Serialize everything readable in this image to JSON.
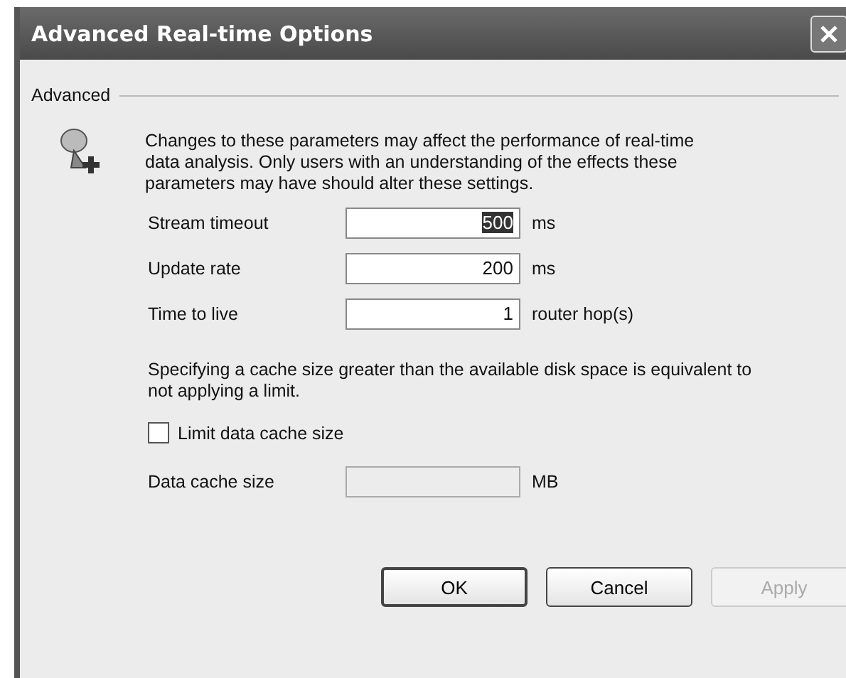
{
  "window": {
    "title": "Advanced Real-time Options"
  },
  "group": {
    "label": "Advanced"
  },
  "intro": "Changes to these parameters may affect the performance of real-time data analysis.  Only users with an understanding of the effects these parameters may have should alter these settings.",
  "fields": [
    {
      "label": "Stream timeout",
      "value": "500",
      "unit": "ms",
      "selected": true
    },
    {
      "label": "Update rate",
      "value": "200",
      "unit": "ms",
      "selected": false
    },
    {
      "label": "Time to live",
      "value": "1",
      "unit": "router hop(s)",
      "selected": false
    }
  ],
  "cache_note": "Specifying a cache size greater than the available disk space is equivalent to not applying a limit.",
  "limit_checkbox": {
    "label": "Limit data cache size",
    "checked": false
  },
  "cache_field": {
    "label": "Data cache size",
    "unit": "MB",
    "disabled": true
  },
  "buttons": [
    {
      "label": "OK",
      "disabled": false,
      "default": true
    },
    {
      "label": "Cancel",
      "disabled": false,
      "default": false
    },
    {
      "label": "Apply",
      "disabled": true,
      "default": false
    }
  ]
}
